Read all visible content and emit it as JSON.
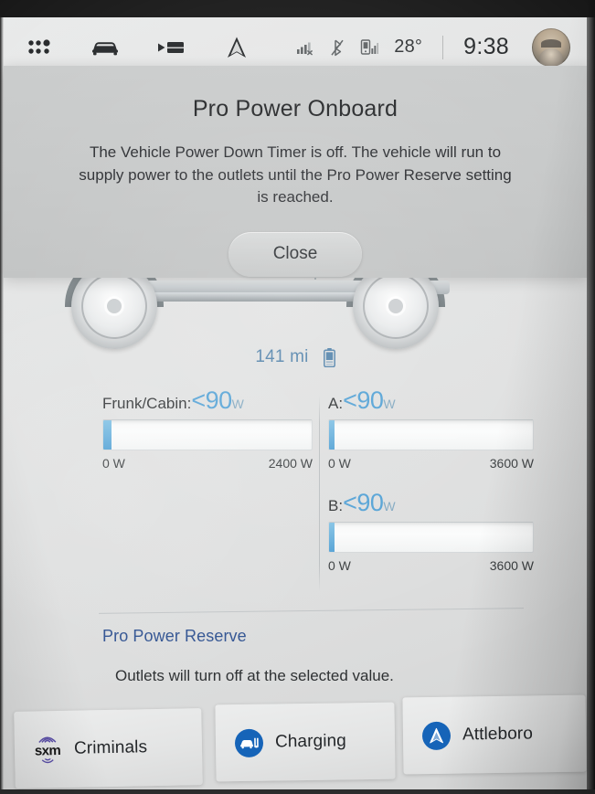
{
  "statusbar": {
    "nav_icons": [
      "apps-grid-icon",
      "vehicle-icon",
      "media-icon",
      "navigation-icon"
    ],
    "signal_icon": "cellular-signal-off-icon",
    "bluetooth_icon": "bluetooth-off-icon",
    "phone_icon": "phone-signal-icon",
    "temperature": "28°",
    "time": "9:38",
    "avatar": "user-avatar"
  },
  "vehicle": {
    "range": "141 mi",
    "battery_icon": "battery-icon"
  },
  "dialog": {
    "title": "Pro Power Onboard",
    "body": "The Vehicle Power Down Timer is off. The vehicle will run to supply power to the outlets until the Pro Power Reserve setting is reached.",
    "close_label": "Close"
  },
  "outlets": [
    {
      "name": "Frunk/Cabin:",
      "value": "<90",
      "unit": "W",
      "min_label": "0 W",
      "max_label": "2400 W",
      "fill_percent": 3.75
    },
    {
      "name": "A:",
      "value": "<90",
      "unit": "W",
      "min_label": "0 W",
      "max_label": "3600 W",
      "fill_percent": 2.5
    },
    {
      "name": "B:",
      "value": "<90",
      "unit": "W",
      "min_label": "0 W",
      "max_label": "3600 W",
      "fill_percent": 2.5
    }
  ],
  "reserve": {
    "link": "Pro Power Reserve",
    "note": "Outlets will turn off at the selected value."
  },
  "cards": [
    {
      "label": "Criminals",
      "icon": "sxm-icon",
      "brand": "sxm"
    },
    {
      "label": "Charging",
      "icon": "charging-icon"
    },
    {
      "label": "Attleboro",
      "icon": "navigation-arrow-icon"
    }
  ],
  "colors": {
    "accent_blue": "#4e9fd4",
    "link_blue": "#2c4f8f",
    "icon_blue": "#1664b8"
  }
}
